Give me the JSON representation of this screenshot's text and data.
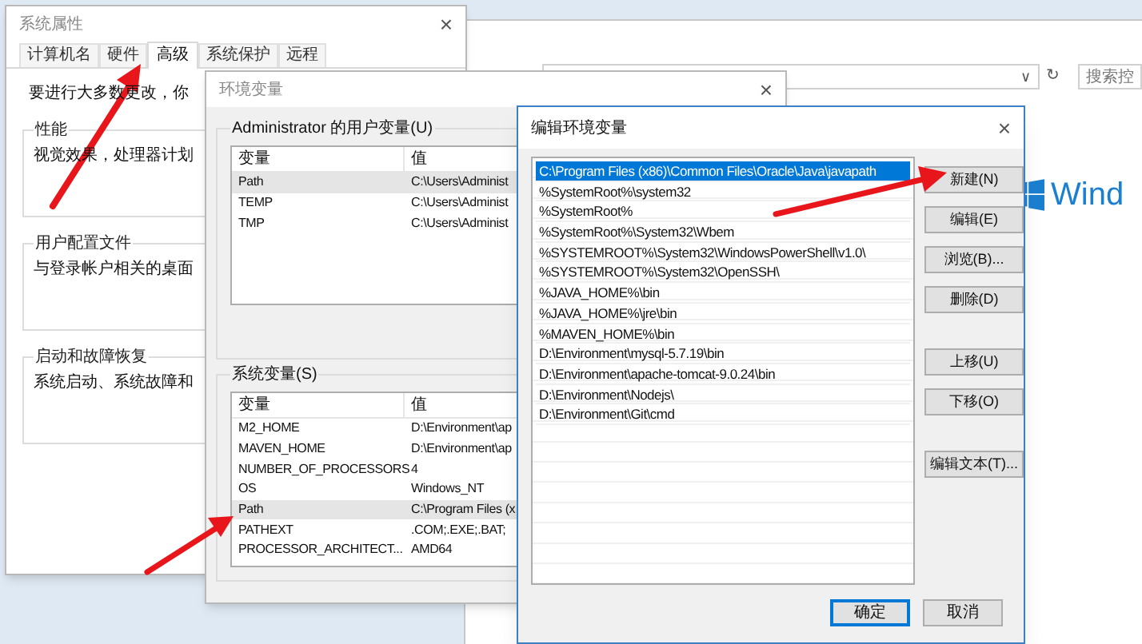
{
  "background_window": {
    "address_dropdown": "∨",
    "refresh": "↻",
    "search": {
      "placeholder": "搜索控"
    },
    "logo_text": "Wind"
  },
  "system_properties": {
    "title": "系统属性",
    "close": "×",
    "tabs": [
      {
        "label": "计算机名",
        "selected": false
      },
      {
        "label": "硬件",
        "selected": false
      },
      {
        "label": "高级",
        "selected": true
      },
      {
        "label": "系统保护",
        "selected": false
      },
      {
        "label": "远程",
        "selected": false
      }
    ],
    "notice": "要进行大多数更改，你",
    "groups": [
      {
        "title": "性能",
        "text": "视觉效果，处理器计划"
      },
      {
        "title": "用户配置文件",
        "text": "与登录帐户相关的桌面"
      },
      {
        "title": "启动和故障恢复",
        "text": "系统启动、系统故障和"
      }
    ]
  },
  "environment_variables": {
    "title": "环境变量",
    "close": "×",
    "user_vars": {
      "title": "Administrator 的用户变量(U)",
      "columns": [
        "变量",
        "值"
      ],
      "rows": [
        {
          "name": "Path",
          "value": "C:\\Users\\Administ",
          "selected": true
        },
        {
          "name": "TEMP",
          "value": "C:\\Users\\Administ",
          "selected": false
        },
        {
          "name": "TMP",
          "value": "C:\\Users\\Administ",
          "selected": false
        }
      ]
    },
    "system_vars": {
      "title": "系统变量(S)",
      "columns": [
        "变量",
        "值"
      ],
      "rows": [
        {
          "name": "M2_HOME",
          "value": "D:\\Environment\\ap",
          "selected": false
        },
        {
          "name": "MAVEN_HOME",
          "value": "D:\\Environment\\ap",
          "selected": false
        },
        {
          "name": "NUMBER_OF_PROCESSORS",
          "value": "4",
          "selected": false
        },
        {
          "name": "OS",
          "value": "Windows_NT",
          "selected": false
        },
        {
          "name": "Path",
          "value": "C:\\Program Files (x",
          "selected": true
        },
        {
          "name": "PATHEXT",
          "value": ".COM;.EXE;.BAT;",
          "selected": false
        },
        {
          "name": "PROCESSOR_ARCHITECT...",
          "value": "AMD64",
          "selected": false
        }
      ]
    }
  },
  "edit_variable": {
    "title": "编辑环境变量",
    "close": "×",
    "entries": [
      {
        "text": "C:\\Program Files (x86)\\Common Files\\Oracle\\Java\\javapath",
        "selected": true
      },
      {
        "text": "%SystemRoot%\\system32",
        "selected": false
      },
      {
        "text": "%SystemRoot%",
        "selected": false
      },
      {
        "text": "%SystemRoot%\\System32\\Wbem",
        "selected": false
      },
      {
        "text": "%SYSTEMROOT%\\System32\\WindowsPowerShell\\v1.0\\",
        "selected": false
      },
      {
        "text": "%SYSTEMROOT%\\System32\\OpenSSH\\",
        "selected": false
      },
      {
        "text": "%JAVA_HOME%\\bin",
        "selected": false
      },
      {
        "text": "%JAVA_HOME%\\jre\\bin",
        "selected": false
      },
      {
        "text": "%MAVEN_HOME%\\bin",
        "selected": false
      },
      {
        "text": "D:\\Environment\\mysql-5.7.19\\bin",
        "selected": false
      },
      {
        "text": "D:\\Environment\\apache-tomcat-9.0.24\\bin",
        "selected": false
      },
      {
        "text": "D:\\Environment\\Nodejs\\",
        "selected": false
      },
      {
        "text": "D:\\Environment\\Git\\cmd",
        "selected": false
      }
    ],
    "button_groups": [
      [
        "新建(N)",
        "编辑(E)",
        "浏览(B)...",
        "删除(D)"
      ],
      [
        "上移(U)",
        "下移(O)"
      ],
      [
        "编辑文本(T)..."
      ]
    ],
    "footer_buttons": [
      {
        "label": "确定",
        "default": true
      },
      {
        "label": "取消",
        "default": false
      }
    ]
  }
}
